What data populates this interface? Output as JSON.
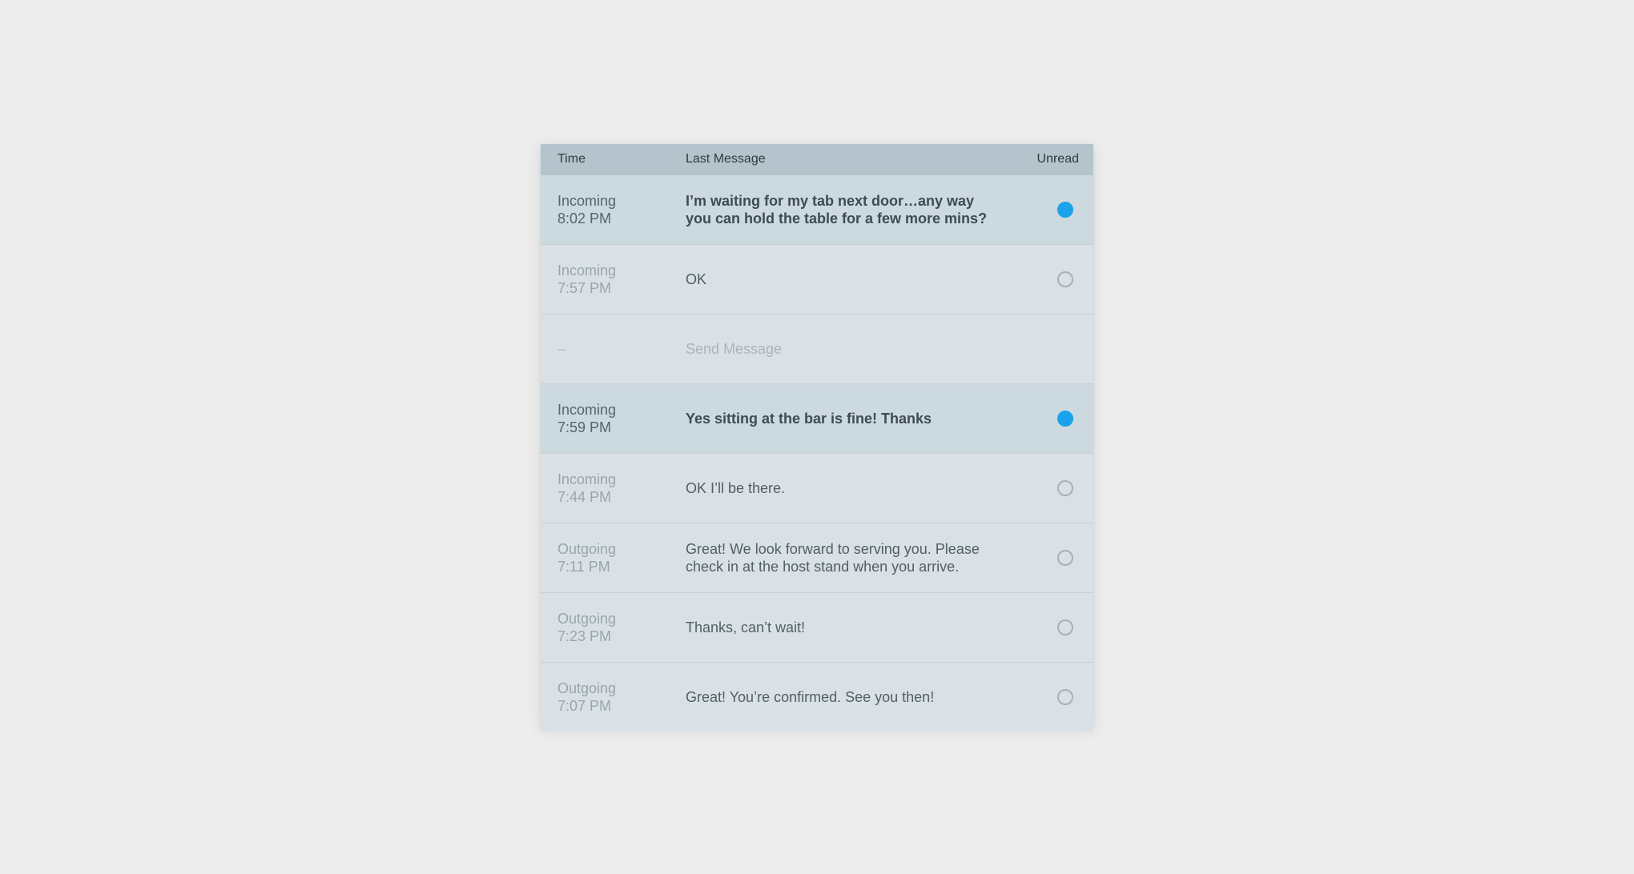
{
  "table": {
    "headers": {
      "time": "Time",
      "message": "Last Message",
      "unread": "Unread"
    },
    "rows": [
      {
        "direction": "Incoming",
        "time": "8:02 PM",
        "message": "I’m waiting for my tab next door…any way you can hold the table for a few more mins?",
        "unread": true
      },
      {
        "direction": "Incoming",
        "time": "7:57 PM",
        "message": "OK",
        "unread": false
      },
      {
        "direction": "–",
        "time": "",
        "message": "Send Message",
        "unread": null
      },
      {
        "direction": "Incoming",
        "time": "7:59 PM",
        "message": "Yes sitting at the bar is fine! Thanks",
        "unread": true
      },
      {
        "direction": "Incoming",
        "time": "7:44 PM",
        "message": "OK I’ll be there.",
        "unread": false
      },
      {
        "direction": "Outgoing",
        "time": "7:11 PM",
        "message": "Great! We look forward to serving you. Please check in at the host stand when you arrive.",
        "unread": false
      },
      {
        "direction": "Outgoing",
        "time": "7:23 PM",
        "message": "Thanks, can’t wait!",
        "unread": false
      },
      {
        "direction": "Outgoing",
        "time": "7:07 PM",
        "message": "Great! You’re confirmed. See you then!",
        "unread": false
      }
    ]
  },
  "colors": {
    "unread_dot": "#1aa3eb",
    "header_bg": "#b5c4cc",
    "row_bg": "#dae1e5",
    "unread_row_bg": "#ccd9df"
  }
}
